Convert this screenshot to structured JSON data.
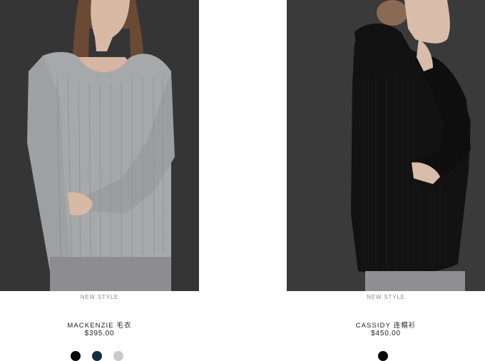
{
  "products": [
    {
      "badge": "NEW STYLE",
      "name": "MACKENZIE 毛衣",
      "price": "$395.00",
      "image_alt": "Gray ribbed sweater",
      "swatches": [
        {
          "name": "black",
          "color": "#0b0b0b"
        },
        {
          "name": "navy",
          "color": "#172a44"
        },
        {
          "name": "light-gray",
          "color": "#c9c9c9"
        }
      ]
    },
    {
      "badge": "NEW STYLE",
      "name": "CASSIDY 连帽衫",
      "price": "$450.00",
      "image_alt": "Black knit hoodie",
      "swatches": [
        {
          "name": "black",
          "color": "#0b0b0b"
        }
      ]
    }
  ]
}
